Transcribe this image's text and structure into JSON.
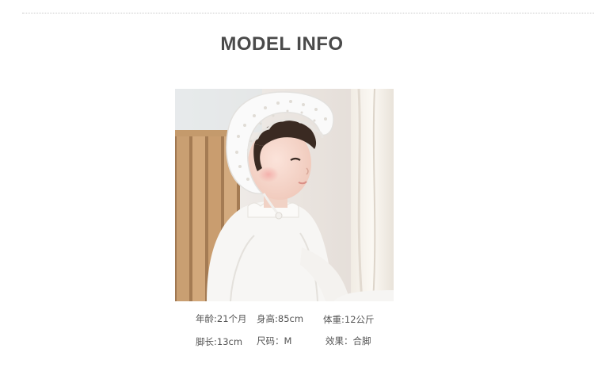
{
  "header": {
    "title": "MODEL INFO"
  },
  "model_photo": {
    "description_icon": "baby-in-white-lace-bonnet-photo"
  },
  "model_info": {
    "row1": {
      "age": "年龄:21个月",
      "height": "身高:85cm",
      "weight": "体重:12公斤"
    },
    "row2": {
      "foot": "脚长:13cm",
      "size": "尺码：M",
      "fit": "效果：合脚"
    }
  },
  "colors": {
    "title": "#4a4a4a",
    "text": "#555555",
    "divider": "#c9c9c9"
  }
}
